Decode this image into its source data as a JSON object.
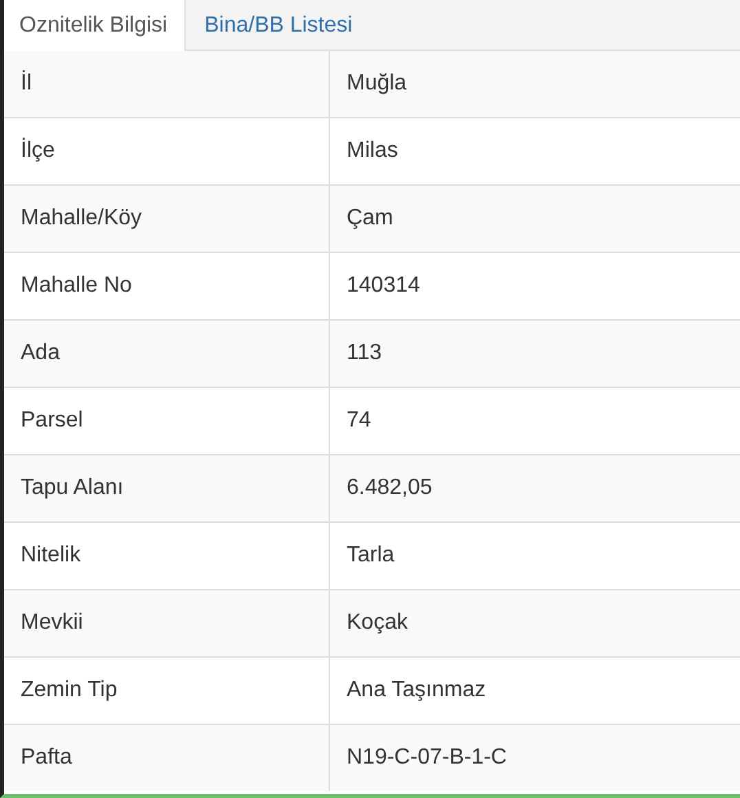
{
  "tabs": [
    {
      "label": "Oznitelik Bilgisi",
      "selected": true
    },
    {
      "label": "Bina/BB Listesi",
      "selected": false
    }
  ],
  "table": {
    "rows": [
      {
        "label": "İl",
        "value": "Muğla"
      },
      {
        "label": "İlçe",
        "value": "Milas"
      },
      {
        "label": "Mahalle/Köy",
        "value": "Çam"
      },
      {
        "label": "Mahalle No",
        "value": "140314"
      },
      {
        "label": "Ada",
        "value": "113"
      },
      {
        "label": "Parsel",
        "value": "74"
      },
      {
        "label": "Tapu Alanı",
        "value": "6.482,05"
      },
      {
        "label": "Nitelik",
        "value": "Tarla"
      },
      {
        "label": "Mevkii",
        "value": "Koçak"
      },
      {
        "label": "Zemin Tip",
        "value": "Ana Taşınmaz"
      },
      {
        "label": "Pafta",
        "value": "N19-C-07-B-1-C"
      }
    ]
  }
}
